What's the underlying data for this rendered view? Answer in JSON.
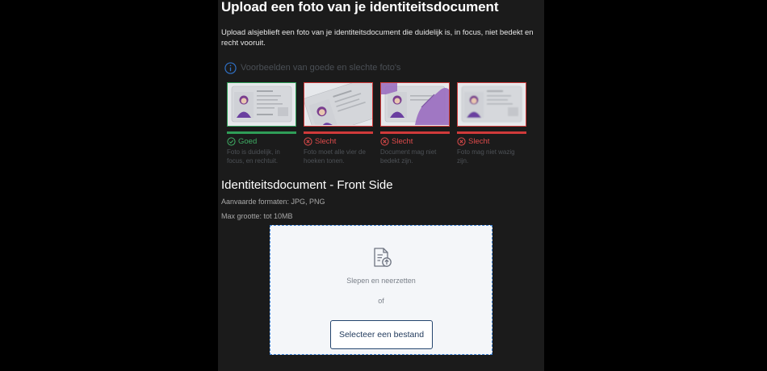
{
  "page": {
    "title": "Upload een foto van je identiteitsdocument",
    "intro": "Upload alsjeblieft een foto van je identiteitsdocument die duidelijk is, in focus, niet bedekt en recht vooruit."
  },
  "examples": {
    "label": "Voorbeelden van goede en slechte foto's",
    "items": [
      {
        "status": "Goed",
        "desc": "Foto is duidelijk, in focus, en rechtuit.",
        "quality": "good"
      },
      {
        "status": "Slecht",
        "desc": "Foto moet alle vier de hoeken tonen.",
        "quality": "bad"
      },
      {
        "status": "Slecht",
        "desc": "Document mag niet bedekt zijn.",
        "quality": "bad"
      },
      {
        "status": "Slecht",
        "desc": "Foto mag niet wazig zijn.",
        "quality": "bad"
      }
    ]
  },
  "document": {
    "title": "Identiteitsdocument - Front Side",
    "formats": "Aanvaarde formaten: JPG, PNG",
    "max_size": "Max grootte: tot 10MB"
  },
  "dropzone": {
    "drag_text": "Slepen en neerzetten",
    "or_text": "of",
    "button_label": "Selecteer een bestand"
  },
  "colors": {
    "good": "#2f9e58",
    "bad": "#d03a3a",
    "accent": "#3f83d6",
    "panel_bg": "#1b1b1b"
  }
}
